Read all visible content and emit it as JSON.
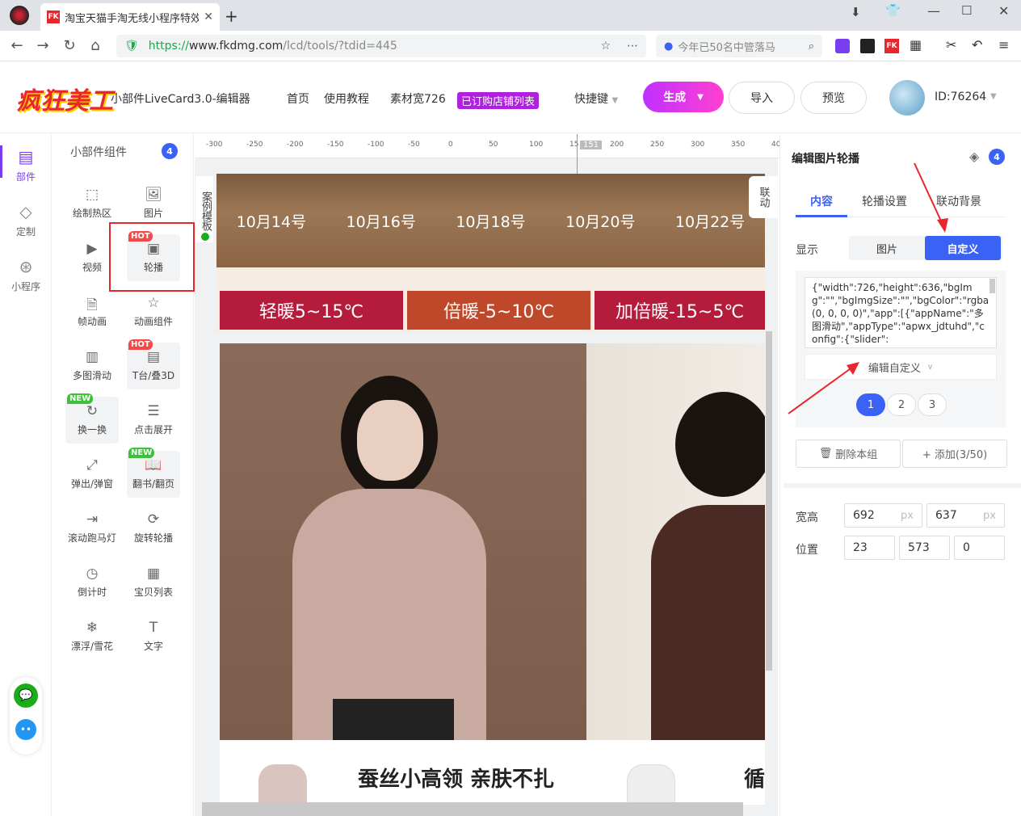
{
  "browser": {
    "tab_title": "淘宝天猫手淘无线小程序特效",
    "tab_icon": "FK",
    "url_prefix": "https://",
    "url_host": "www.fkdmg.com",
    "url_path": "/lcd/tools/?tdid=445",
    "search_placeholder": "今年已50名中管落马"
  },
  "header": {
    "logo": "疯狂美工",
    "app_title": "小部件LiveCard3.0-编辑器",
    "nav": [
      "首页",
      "使用教程",
      "素材宽726"
    ],
    "badge": "已订购店铺列表",
    "shortcut": "快捷键",
    "generate": "生成",
    "import": "导入",
    "preview": "预览",
    "user_id": "ID:76264"
  },
  "rail": [
    {
      "label": "部件",
      "icon": "widgets-icon"
    },
    {
      "label": "定制",
      "icon": "diamond-icon"
    },
    {
      "label": "小程序",
      "icon": "mini-program-icon"
    }
  ],
  "components": {
    "title": "小部件组件",
    "count": "4",
    "items": [
      {
        "label": "绘制热区",
        "icon": "hotspot-icon",
        "tag": ""
      },
      {
        "label": "图片",
        "icon": "image-icon",
        "tag": ""
      },
      {
        "label": "视频",
        "icon": "video-icon",
        "tag": ""
      },
      {
        "label": "轮播",
        "icon": "carousel-icon",
        "tag": "HOT"
      },
      {
        "label": "帧动画",
        "icon": "frame-icon",
        "tag": ""
      },
      {
        "label": "动画组件",
        "icon": "star-icon",
        "tag": ""
      },
      {
        "label": "多图滑动",
        "icon": "multi-slide-icon",
        "tag": ""
      },
      {
        "label": "T台/叠3D",
        "icon": "stage-3d-icon",
        "tag": "HOT"
      },
      {
        "label": "换一换",
        "icon": "refresh-icon",
        "tag": "NEW"
      },
      {
        "label": "点击展开",
        "icon": "expand-icon",
        "tag": ""
      },
      {
        "label": "弹出/弹窗",
        "icon": "popup-icon",
        "tag": ""
      },
      {
        "label": "翻书/翻页",
        "icon": "book-icon",
        "tag": "NEW"
      },
      {
        "label": "滚动跑马灯",
        "icon": "marquee-icon",
        "tag": ""
      },
      {
        "label": "旋转轮播",
        "icon": "rotate-icon",
        "tag": ""
      },
      {
        "label": "倒计时",
        "icon": "clock-icon",
        "tag": ""
      },
      {
        "label": "宝贝列表",
        "icon": "grid-list-icon",
        "tag": ""
      },
      {
        "label": "漂浮/雪花",
        "icon": "snowflake-icon",
        "tag": ""
      },
      {
        "label": "文字",
        "icon": "text-icon",
        "tag": ""
      }
    ]
  },
  "canvas": {
    "ruler_ticks": [
      "-300",
      "-250",
      "-200",
      "-150",
      "-100",
      "-50",
      "0",
      "50",
      "100",
      "15",
      "200",
      "250",
      "300",
      "350",
      "40"
    ],
    "ruler_marker": "151",
    "left_label": "案例模板",
    "right_label": "联动",
    "dates": [
      "10月14号",
      "10月16号",
      "10月18号",
      "10月20号",
      "10月22号"
    ],
    "temps": [
      {
        "label": "轻暖5~15℃",
        "color": "#b51c3c"
      },
      {
        "label": "倍暖-5~10℃",
        "color": "#c0482a"
      },
      {
        "label": "加倍暖-15~5℃",
        "color": "#b51c3c"
      }
    ],
    "slogan": "蚕丝小高领 亲肤不扎",
    "slogan_cut": "循"
  },
  "panel": {
    "title": "编辑图片轮播",
    "count": "4",
    "tabs": [
      "内容",
      "轮播设置",
      "联动背景"
    ],
    "display_label": "显示",
    "display_options": [
      "图片",
      "自定义"
    ],
    "code": "{\"width\":726,\"height\":636,\"bgImg\":\"\",\"bgImgSize\":\"\",\"bgColor\":\"rgba(0, 0, 0, 0)\",\"app\":[{\"appName\":\"多图滑动\",\"appType\":\"apwx_jdtuhd\",\"config\":{\"slider\":",
    "edit_custom": "编辑自定义",
    "pages": [
      "1",
      "2",
      "3"
    ],
    "delete_group": "删除本组",
    "add_group": "+ 添加(3/50)",
    "size_label": "宽高",
    "width": "692",
    "height": "637",
    "unit": "px",
    "pos_label": "位置",
    "pos_x": "23",
    "pos_y": "573",
    "pos_z": "0"
  }
}
